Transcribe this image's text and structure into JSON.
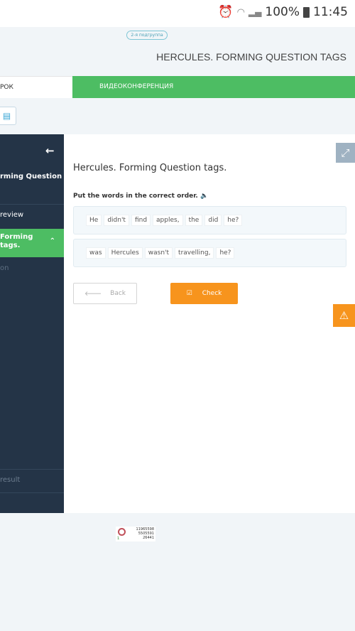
{
  "status_bar": {
    "battery": "100%",
    "time": "11:45",
    "icons": [
      "alarm-icon",
      "wifi-icon",
      "signal-icon",
      "battery-icon"
    ]
  },
  "header": {
    "badge": "2-я подгруппа",
    "title": "HERCULES. FORMING QUESTION TAGS"
  },
  "tabs": [
    {
      "label": "РОК"
    },
    {
      "label": "ВИДЕОКОНФЕРЕНЦИЯ"
    }
  ],
  "colors": {
    "green": "#4dbd63",
    "sidebar": "#243447",
    "orange": "#f7941d"
  },
  "sidebar": {
    "title": "rming Question",
    "items": [
      {
        "label": "review"
      },
      {
        "label": "Forming tags."
      },
      {
        "label": "on"
      },
      {
        "label": "result"
      }
    ]
  },
  "main": {
    "title": "Hercules. Forming Question tags.",
    "instruction": "Put the words in the correct order.",
    "rows": [
      [
        "He",
        "didn't",
        "find",
        "apples,",
        "the",
        "did",
        "he?"
      ],
      [
        "was",
        "Hercules",
        "wasn't",
        "travelling,",
        "he?"
      ]
    ],
    "back_label": "Back",
    "check_label": "Check"
  },
  "counter": {
    "lines": [
      "11965598",
      "5505591",
      "26441"
    ],
    "left": "1"
  }
}
